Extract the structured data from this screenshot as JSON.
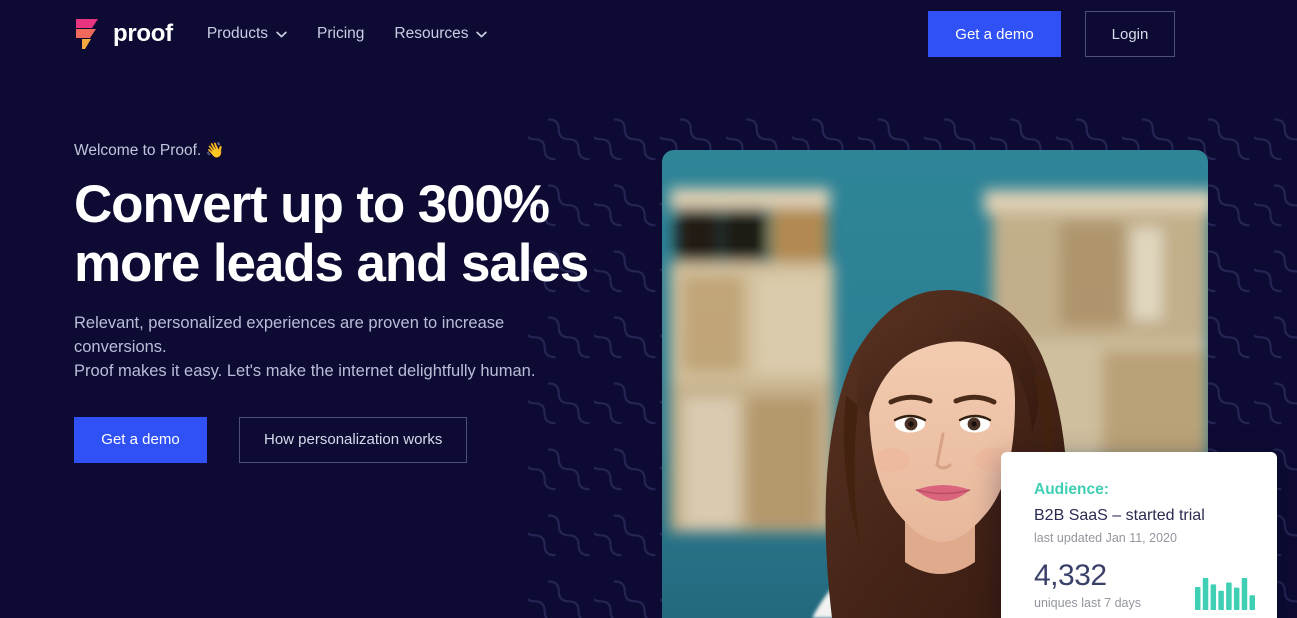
{
  "brand": {
    "name": "proof",
    "logo_icon": "proof-flag-logo",
    "colors": {
      "pink": "#e9357f",
      "coral": "#f2734f",
      "orange": "#f6a93c"
    }
  },
  "nav": {
    "links": [
      {
        "label": "Products",
        "has_dropdown": true,
        "icon": "chevron-down-icon"
      },
      {
        "label": "Pricing",
        "has_dropdown": false,
        "icon": ""
      },
      {
        "label": "Resources",
        "has_dropdown": true,
        "icon": "chevron-down-icon"
      }
    ],
    "demo_label": "Get a demo",
    "login_label": "Login"
  },
  "hero": {
    "eyebrow": "Welcome to Proof.",
    "eyebrow_emoji": "👋",
    "title_line1": "Convert up to 300%",
    "title_line2": "more leads and sales",
    "sub_line1": "Relevant, personalized experiences are proven to increase conversions.",
    "sub_line2": "Proof makes it easy. Let's make the internet delightfully human.",
    "cta_primary": "Get a demo",
    "cta_secondary": "How personalization works"
  },
  "stat_card": {
    "audience_label": "Audience:",
    "segment": "B2B SaaS – started trial",
    "updated": "last updated Jan 11, 2020",
    "value": "4,332",
    "caption": "uniques last 7 days",
    "spark_color": "#3ecfb4"
  },
  "chart_data": {
    "type": "bar",
    "title": "",
    "categories": [
      "1",
      "2",
      "3",
      "4",
      "5",
      "6",
      "7",
      "8"
    ],
    "values": [
      72,
      100,
      80,
      60,
      86,
      70,
      100,
      46
    ],
    "xlabel": "",
    "ylabel": "",
    "ylim": [
      0,
      100
    ],
    "grid": false,
    "legend": "none",
    "series_color": "#3ecfb4"
  },
  "theme": {
    "background": "#0d0b33",
    "accent_blue": "#2f51f6",
    "text_light": "#ffffff",
    "text_muted": "#b9bed8",
    "photo_backdrop": "#2d7f94"
  }
}
